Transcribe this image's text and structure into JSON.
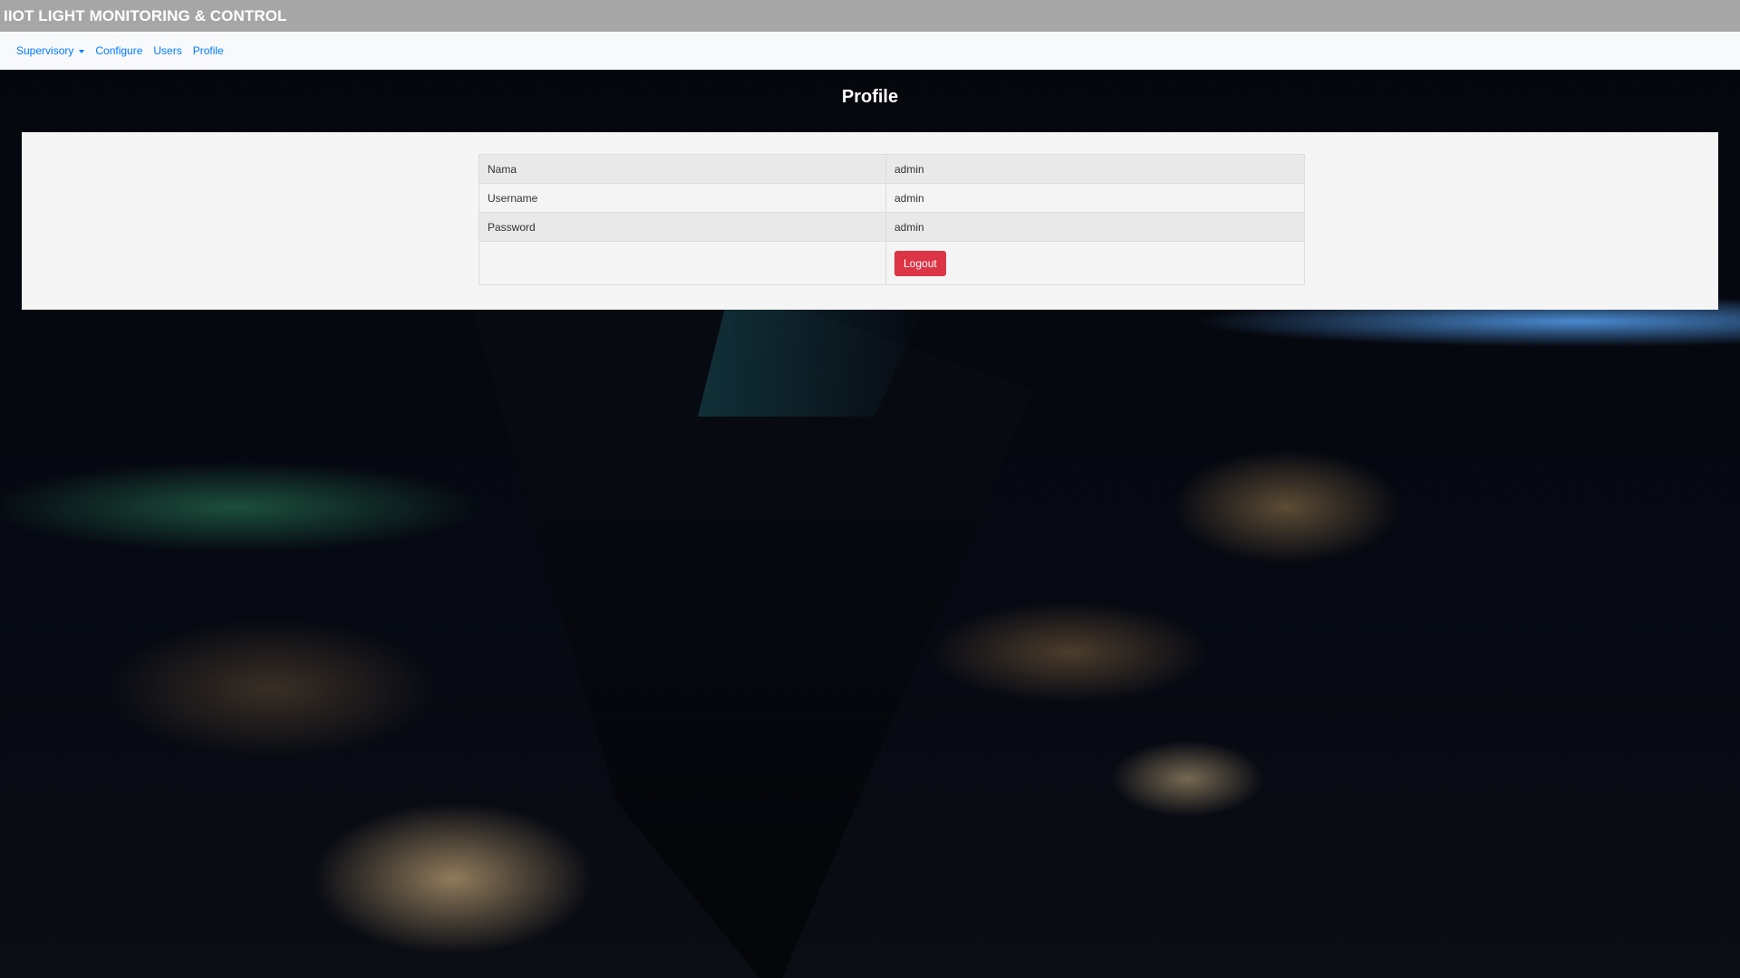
{
  "app": {
    "title": "IIOT LIGHT MONITORING & CONTROL"
  },
  "nav": {
    "items": [
      {
        "label": "Supervisory",
        "dropdown": true
      },
      {
        "label": "Configure"
      },
      {
        "label": "Users"
      },
      {
        "label": "Profile"
      }
    ]
  },
  "page": {
    "title": "Profile"
  },
  "profile": {
    "rows": [
      {
        "label": "Nama",
        "value": "admin"
      },
      {
        "label": "Username",
        "value": "admin"
      },
      {
        "label": "Password",
        "value": "admin"
      }
    ],
    "logout_label": "Logout"
  },
  "colors": {
    "topbar": "#a6a6a6",
    "link": "#007bff",
    "logout": "#dc3545"
  },
  "background": {
    "icon": "night-earth-photo"
  }
}
